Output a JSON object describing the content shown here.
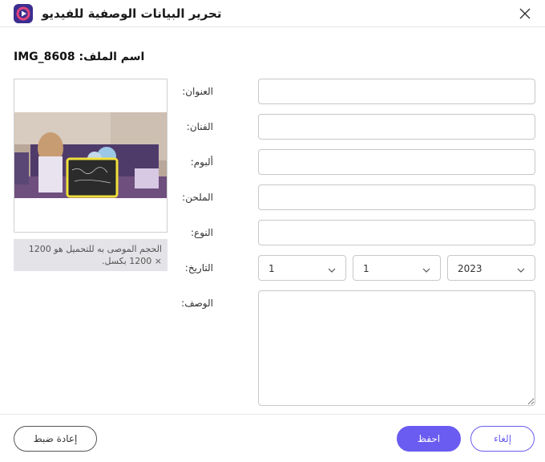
{
  "window": {
    "title": "تحرير البيانات الوصفية للفيديو"
  },
  "file": {
    "name_label": "IMG_8608 :اسم الملف"
  },
  "thumbnail": {
    "hint": "الحجم الموصى به للتحميل هو 1200 × 1200 بكسل."
  },
  "fields": {
    "title_label": "العنوان:",
    "artist_label": "الفنان:",
    "album_label": "ألبوم:",
    "composer_label": "الملحن:",
    "genre_label": "النوع:",
    "date_label": "التاريخ:",
    "description_label": "الوصف:",
    "title_value": "",
    "artist_value": "",
    "album_value": "",
    "composer_value": "",
    "genre_value": ""
  },
  "date": {
    "first": "1",
    "second": "1",
    "year": "2023"
  },
  "buttons": {
    "reset": "إعادة ضبط",
    "save": "احفظ",
    "cancel": "إلغاء"
  },
  "colors": {
    "accent": "#6a5cf0",
    "app_icon": "#3b2e8f"
  }
}
